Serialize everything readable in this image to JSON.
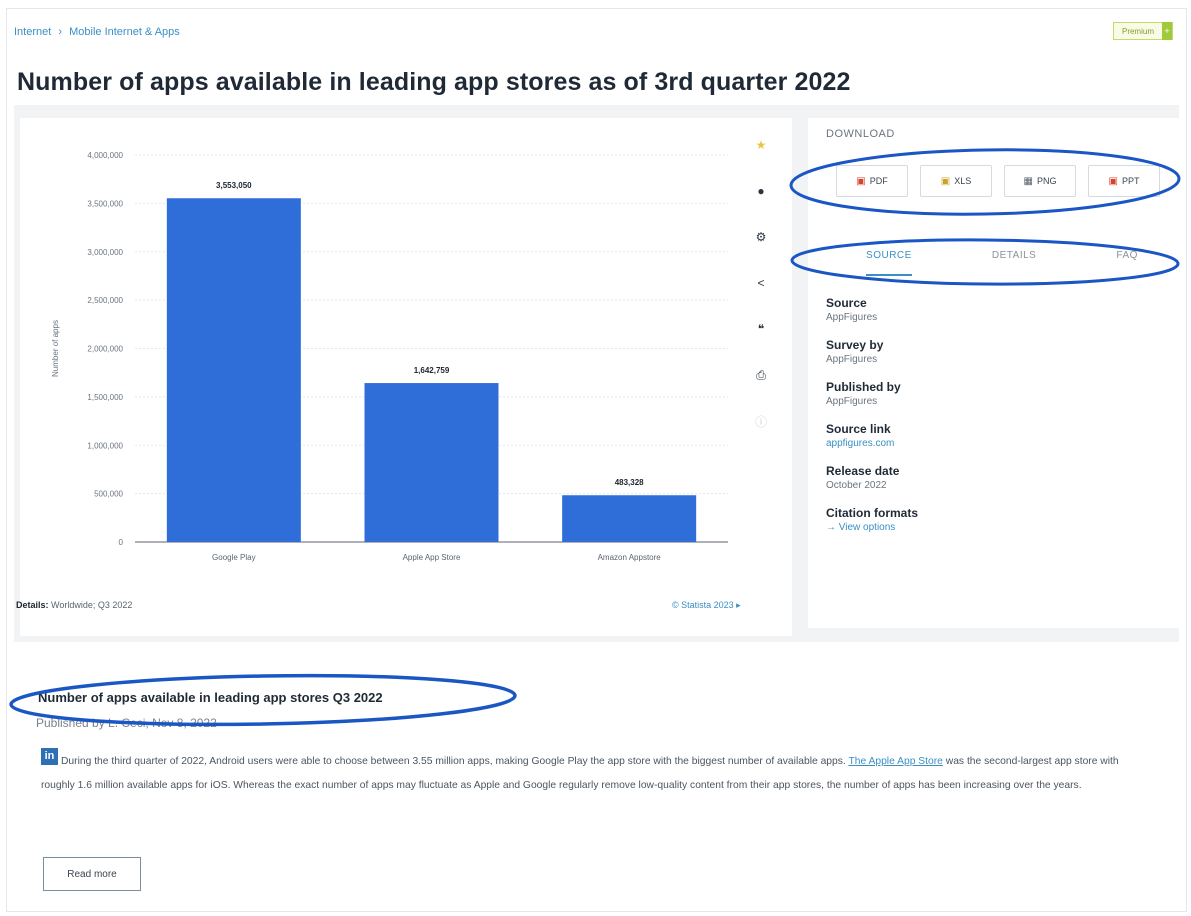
{
  "breadcrumb": [
    "Internet",
    "›",
    "Mobile Internet & Apps"
  ],
  "premium_label": "Premium",
  "premium_tip": "+",
  "page_title": "Number of apps available in leading app stores as of 3rd quarter 2022",
  "chart_data": {
    "type": "bar",
    "title": "",
    "ylabel": "Number of apps",
    "xlabel": "",
    "categories": [
      "Google Play",
      "Apple App Store",
      "Amazon Appstore"
    ],
    "values": [
      3553050,
      1642759,
      483328
    ],
    "value_labels": [
      "3,553,050",
      "1,642,759",
      "483,328"
    ],
    "ylim": [
      0,
      4000000
    ],
    "ytick_values": [
      0,
      500000,
      1000000,
      1500000,
      2000000,
      2500000,
      3000000,
      3500000,
      4000000
    ],
    "ytick_labels": [
      "0",
      "500,000",
      "1,000,000",
      "1,500,000",
      "2,000,000",
      "2,500,000",
      "3,000,000",
      "3,500,000",
      "4,000,000"
    ],
    "bar_color": "#2f6ed8",
    "grid": true,
    "legend": "none"
  },
  "chart_footer": {
    "details_label": "Details:",
    "details_value": "Worldwide; Q3 2022",
    "credit": "© Statista 2023"
  },
  "tools": [
    {
      "icon": "star-icon",
      "glyph": "★"
    },
    {
      "icon": "bell-icon",
      "glyph": "●"
    },
    {
      "icon": "gear-icon",
      "glyph": "⚙"
    },
    {
      "icon": "share-icon",
      "glyph": "<"
    },
    {
      "icon": "quote-icon",
      "glyph": "❝"
    },
    {
      "icon": "print-icon",
      "glyph": "⎙"
    },
    {
      "icon": "info-icon",
      "glyph": "ⓘ"
    }
  ],
  "download": {
    "title": "DOWNLOAD",
    "buttons": [
      {
        "label": "PDF",
        "icon": "pdf-icon",
        "glyph": "▣"
      },
      {
        "label": "XLS",
        "icon": "xls-icon",
        "glyph": "▣"
      },
      {
        "label": "PNG",
        "icon": "png-icon",
        "glyph": "▦"
      },
      {
        "label": "PPT",
        "icon": "ppt-icon",
        "glyph": "▣"
      }
    ]
  },
  "tabs": [
    {
      "label": "SOURCE",
      "active": true
    },
    {
      "label": "DETAILS",
      "active": false
    },
    {
      "label": "FAQ",
      "active": false
    }
  ],
  "source_info": [
    {
      "label": "Source",
      "value": "AppFigures"
    },
    {
      "label": "Survey by",
      "value": "AppFigures"
    },
    {
      "label": "Published by",
      "value": "AppFigures"
    },
    {
      "label": "Source link",
      "value": "appfigures.com"
    },
    {
      "label": "Release date",
      "value": "October 2022"
    },
    {
      "label": "Citation formats",
      "value": "→ View options"
    }
  ],
  "article": {
    "title": "Number of apps available in leading app stores Q3 2022",
    "meta": "Published by L. Ceci, Nov 8, 2022",
    "logo": "in",
    "body_1": "During the third quarter of 2022, Android users were able to choose between 3.55 million apps, making Google Play the app store with the biggest number of available apps. ",
    "body_link": "The Apple App Store",
    "body_2": " was the second-largest app store with roughly 1.6 million available apps for iOS. Whereas the exact number of apps may fluctuate as Apple and Google regularly remove low-quality content from their app stores, the number of apps has been increasing over the years.",
    "read_more": "Read more"
  },
  "colors": {
    "accent": "#3a8fc4",
    "bar": "#2f6ed8",
    "annotation": "#1a56c4"
  }
}
